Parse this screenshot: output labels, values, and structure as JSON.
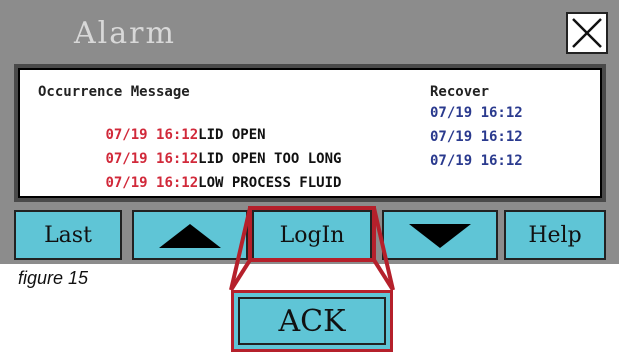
{
  "window": {
    "title": "Alarm",
    "close_icon": "close-icon"
  },
  "alarm_table": {
    "headers": {
      "occurrence_message": "Occurrence Message",
      "recover": "Recover"
    },
    "rows": [
      {
        "occurrence": "07/19 16:12",
        "message": "LID OPEN",
        "recover": "07/19 16:12"
      },
      {
        "occurrence": "07/19 16:12",
        "message": "LID OPEN TOO LONG",
        "recover": "07/19 16:12"
      },
      {
        "occurrence": "07/19 16:12",
        "message": "LOW PROCESS FLUID",
        "recover": "07/19 16:12"
      }
    ]
  },
  "buttons": {
    "last": "Last",
    "up_icon": "triangle-up-icon",
    "login": "LogIn",
    "down_icon": "triangle-down-icon",
    "help": "Help"
  },
  "caption": "figure 15",
  "callout": {
    "ack_label": "ACK"
  },
  "colors": {
    "panel_gray": "#8c8c8c",
    "button_cyan": "#5fc5d6",
    "occurrence_red": "#d1293a",
    "recover_blue": "#2a3a8e",
    "callout_red": "#b5202b"
  }
}
